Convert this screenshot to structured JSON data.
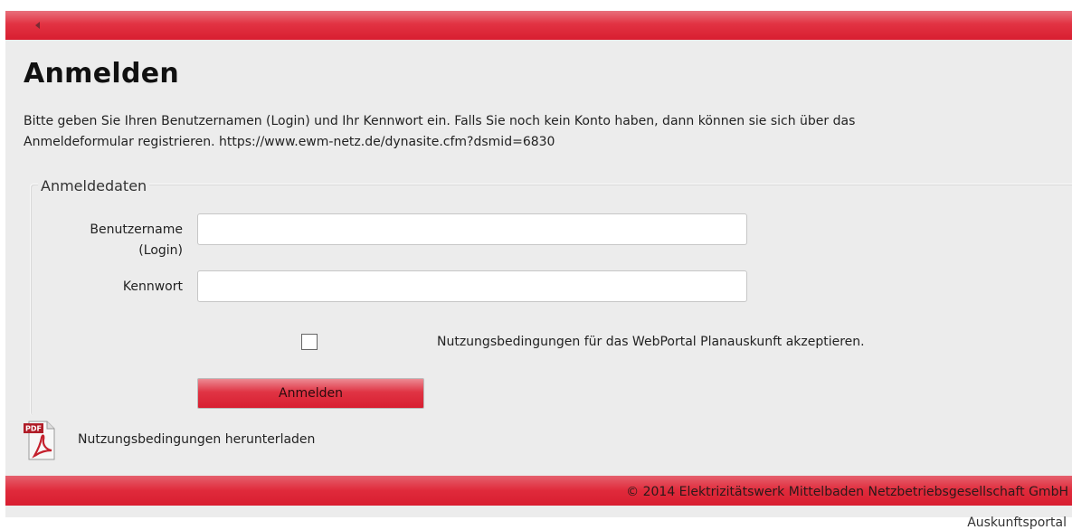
{
  "header": {
    "back_icon": "back-arrow-icon",
    "accent_color": "#e02a3b"
  },
  "main": {
    "title": "Anmelden",
    "intro_line1": "Bitte geben Sie Ihren Benutzernamen (Login) und Ihr Kennwort ein. Falls Sie noch kein Konto haben, dann können sie sich über das",
    "intro_line2": "Anmeldeformular registrieren. https://www.ewm-netz.de/dynasite.cfm?dsmid=6830"
  },
  "form": {
    "legend": "Anmeldedaten",
    "username_label_line1": "Benutzername",
    "username_label_line2": "(Login)",
    "username_value": "",
    "password_label": "Kennwort",
    "password_value": "",
    "terms_checked": false,
    "terms_label": "Nutzungsbedingungen für das WebPortal Planauskunft akzeptieren.",
    "submit_label": "Anmelden"
  },
  "download": {
    "icon": "pdf-icon",
    "icon_text": "PDF",
    "label": "Nutzungsbedingungen herunterladen"
  },
  "footer": {
    "copyright": "© 2014 Elektrizitätswerk Mittelbaden Netzbetriebsgesellschaft GmbH",
    "portal_name": "Auskunftsportal"
  }
}
